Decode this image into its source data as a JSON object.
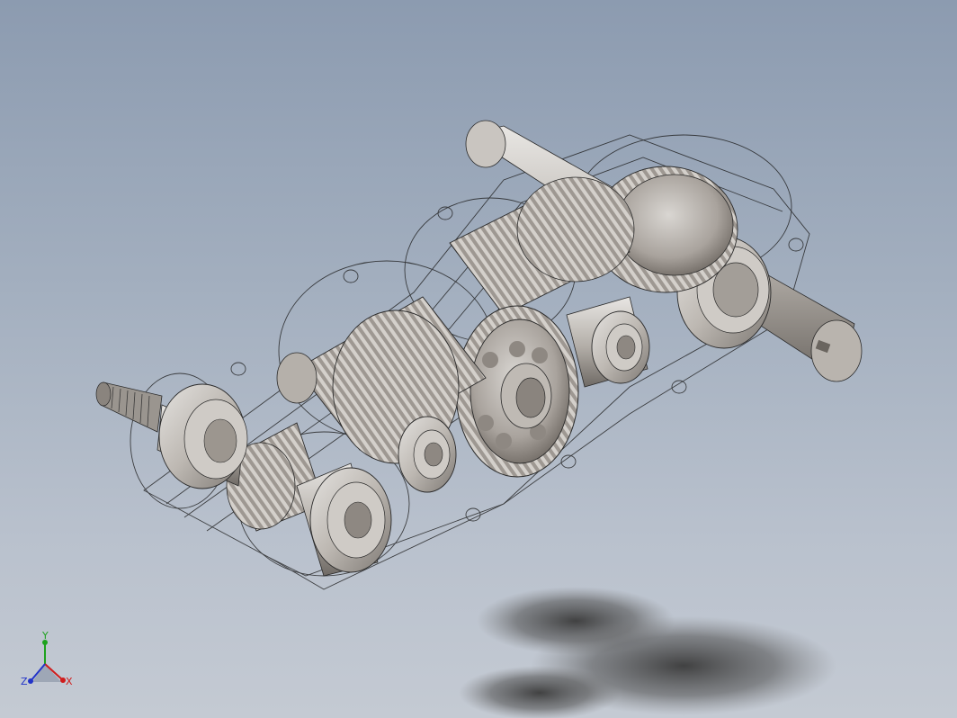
{
  "viewport": {
    "background_top": "#8c9bb0",
    "background_bottom": "#c4cad3",
    "model": "gearbox-assembly"
  },
  "triad": {
    "x_label": "X",
    "y_label": "Y",
    "z_label": "Z",
    "x_color": "#d01c1c",
    "y_color": "#1ea21e",
    "z_color": "#2233c8"
  }
}
